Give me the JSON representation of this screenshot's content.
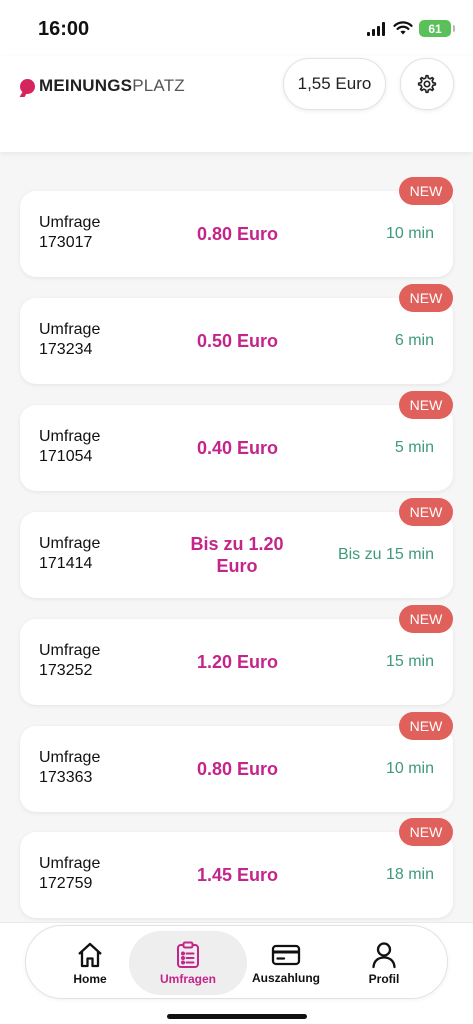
{
  "status_bar": {
    "time": "16:00",
    "battery": "61"
  },
  "header": {
    "logo_bold": "MEINUNGS",
    "logo_light": "PLATZ",
    "balance": "1,55 Euro"
  },
  "surveys": [
    {
      "name": "Umfrage 173017",
      "reward": "0.80 Euro",
      "duration": "10 min",
      "badge": "NEW"
    },
    {
      "name": "Umfrage 173234",
      "reward": "0.50 Euro",
      "duration": "6 min",
      "badge": "NEW"
    },
    {
      "name": "Umfrage 171054",
      "reward": "0.40 Euro",
      "duration": "5 min",
      "badge": "NEW"
    },
    {
      "name": "Umfrage 171414",
      "reward": "Bis zu 1.20 Euro",
      "duration": "Bis zu 15 min",
      "badge": "NEW"
    },
    {
      "name": "Umfrage 173252",
      "reward": "1.20 Euro",
      "duration": "15 min",
      "badge": "NEW"
    },
    {
      "name": "Umfrage 173363",
      "reward": "0.80 Euro",
      "duration": "10 min",
      "badge": "NEW"
    },
    {
      "name": "Umfrage 172759",
      "reward": "1.45 Euro",
      "duration": "18 min",
      "badge": "NEW"
    }
  ],
  "tabs": [
    {
      "label": "Home",
      "icon": "home-icon"
    },
    {
      "label": "Umfragen",
      "icon": "clipboard-list-icon",
      "active": true
    },
    {
      "label": "Auszahlung",
      "icon": "credit-card-icon"
    },
    {
      "label": "Profil",
      "icon": "user-icon"
    }
  ],
  "colors": {
    "brand": "#d6245d",
    "reward": "#c4258a",
    "duration": "#3f9a7b",
    "badge": "#e0605b"
  }
}
